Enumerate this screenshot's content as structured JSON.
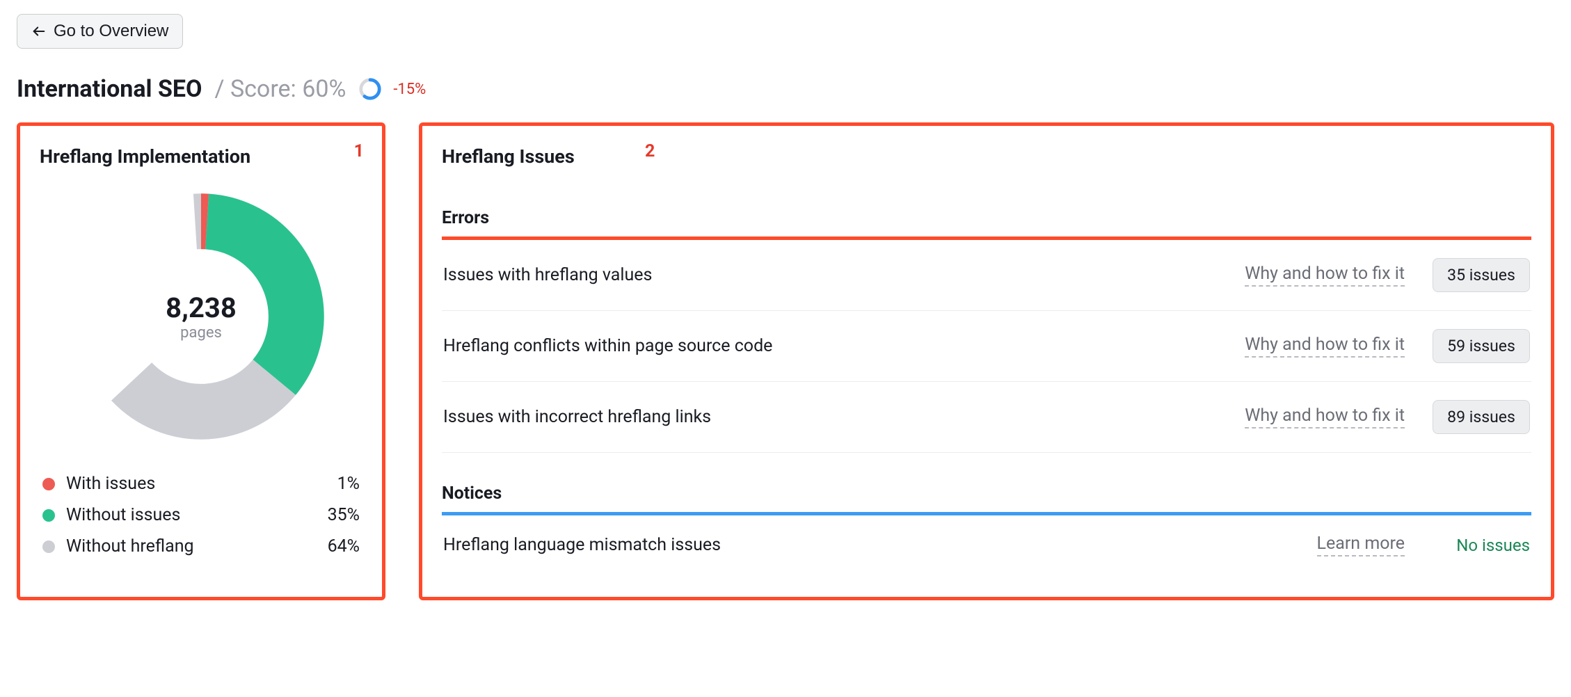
{
  "nav": {
    "back_label": "Go to Overview"
  },
  "header": {
    "title": "International SEO",
    "score_label": "/ Score: 60%",
    "delta": "-15%"
  },
  "annotations": {
    "left": "1",
    "right": "2"
  },
  "implementation": {
    "title": "Hreflang Implementation",
    "total": "8,238",
    "total_unit": "pages",
    "legend": [
      {
        "label": "With issues",
        "pct": "1%",
        "color": "#ed5b54"
      },
      {
        "label": "Without issues",
        "pct": "35%",
        "color": "#29c28f"
      },
      {
        "label": "Without hreflang",
        "pct": "64%",
        "color": "#ccced4"
      }
    ]
  },
  "issues": {
    "title": "Hreflang Issues",
    "errors_header": "Errors",
    "notices_header": "Notices",
    "why_label": "Why and how to fix it",
    "learn_more_label": "Learn more",
    "no_issues_label": "No issues",
    "errors": [
      {
        "name": "Issues with hreflang values",
        "count": "35 issues"
      },
      {
        "name": "Hreflang conflicts within page source code",
        "count": "59 issues"
      },
      {
        "name": "Issues with incorrect hreflang links",
        "count": "89 issues"
      }
    ],
    "notices": [
      {
        "name": "Hreflang language mismatch issues",
        "count": null
      }
    ]
  },
  "chart_data": {
    "type": "pie",
    "title": "Hreflang Implementation",
    "categories": [
      "With issues",
      "Without issues",
      "Without hreflang"
    ],
    "values": [
      1,
      35,
      64
    ],
    "colors": [
      "#ed5b54",
      "#29c28f",
      "#ccced4"
    ],
    "total_label": "8,238",
    "total_unit": "pages"
  }
}
